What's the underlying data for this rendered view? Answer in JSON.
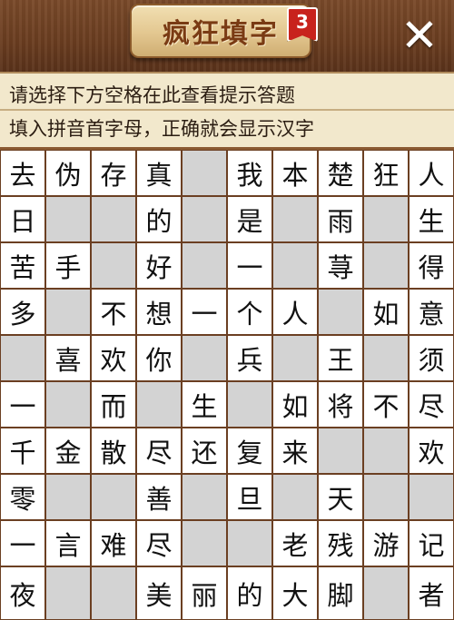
{
  "header": {
    "title": "疯狂填字",
    "level": "3",
    "close_label": "✕"
  },
  "hints": {
    "line1": "请选择下方空格在此查看提示答题",
    "line2": "填入拼音首字母，正确就会显示汉字"
  },
  "grid": {
    "rows": [
      [
        "去",
        "伪",
        "存",
        "真",
        null,
        "我",
        "本",
        "楚",
        "狂",
        "人"
      ],
      [
        "日",
        "",
        "",
        "的",
        null,
        "是",
        null,
        "雨",
        null,
        "生"
      ],
      [
        "苦",
        "手",
        "",
        "好",
        null,
        "一",
        null,
        "荨",
        null,
        "得"
      ],
      [
        "多",
        "",
        "不",
        "想",
        "一",
        "个",
        "人",
        "",
        "如",
        "意"
      ],
      [
        "",
        "喜",
        "欢",
        "你",
        "",
        "兵",
        "",
        "王",
        "",
        "须"
      ],
      [
        "一",
        "",
        "而",
        "",
        "生",
        "",
        "如",
        "将",
        "不",
        "尽"
      ],
      [
        "千",
        "金",
        "散",
        "尽",
        "还",
        "复",
        "来",
        "",
        "",
        "欢"
      ],
      [
        "零",
        "",
        "",
        "善",
        "",
        "旦",
        "",
        "天",
        "",
        ""
      ],
      [
        "一",
        "言",
        "难",
        "尽",
        "",
        "",
        "老",
        "残",
        "游",
        "记"
      ],
      [
        "夜",
        "",
        "",
        "美",
        "丽",
        "的",
        "大",
        "脚",
        "",
        "者"
      ]
    ],
    "white": [
      [
        1,
        1,
        1,
        1,
        0,
        1,
        1,
        1,
        1,
        1
      ],
      [
        1,
        0,
        0,
        1,
        0,
        1,
        0,
        1,
        0,
        1
      ],
      [
        1,
        1,
        0,
        1,
        0,
        1,
        0,
        1,
        0,
        1
      ],
      [
        1,
        0,
        1,
        1,
        1,
        1,
        1,
        0,
        1,
        1
      ],
      [
        0,
        1,
        1,
        1,
        0,
        1,
        0,
        1,
        0,
        1
      ],
      [
        1,
        0,
        1,
        0,
        1,
        0,
        1,
        1,
        1,
        1
      ],
      [
        1,
        1,
        1,
        1,
        1,
        1,
        1,
        0,
        0,
        1
      ],
      [
        1,
        0,
        0,
        1,
        0,
        1,
        0,
        1,
        0,
        0
      ],
      [
        1,
        1,
        1,
        1,
        0,
        0,
        1,
        1,
        1,
        1
      ],
      [
        1,
        0,
        0,
        1,
        1,
        1,
        1,
        1,
        0,
        1
      ]
    ]
  }
}
